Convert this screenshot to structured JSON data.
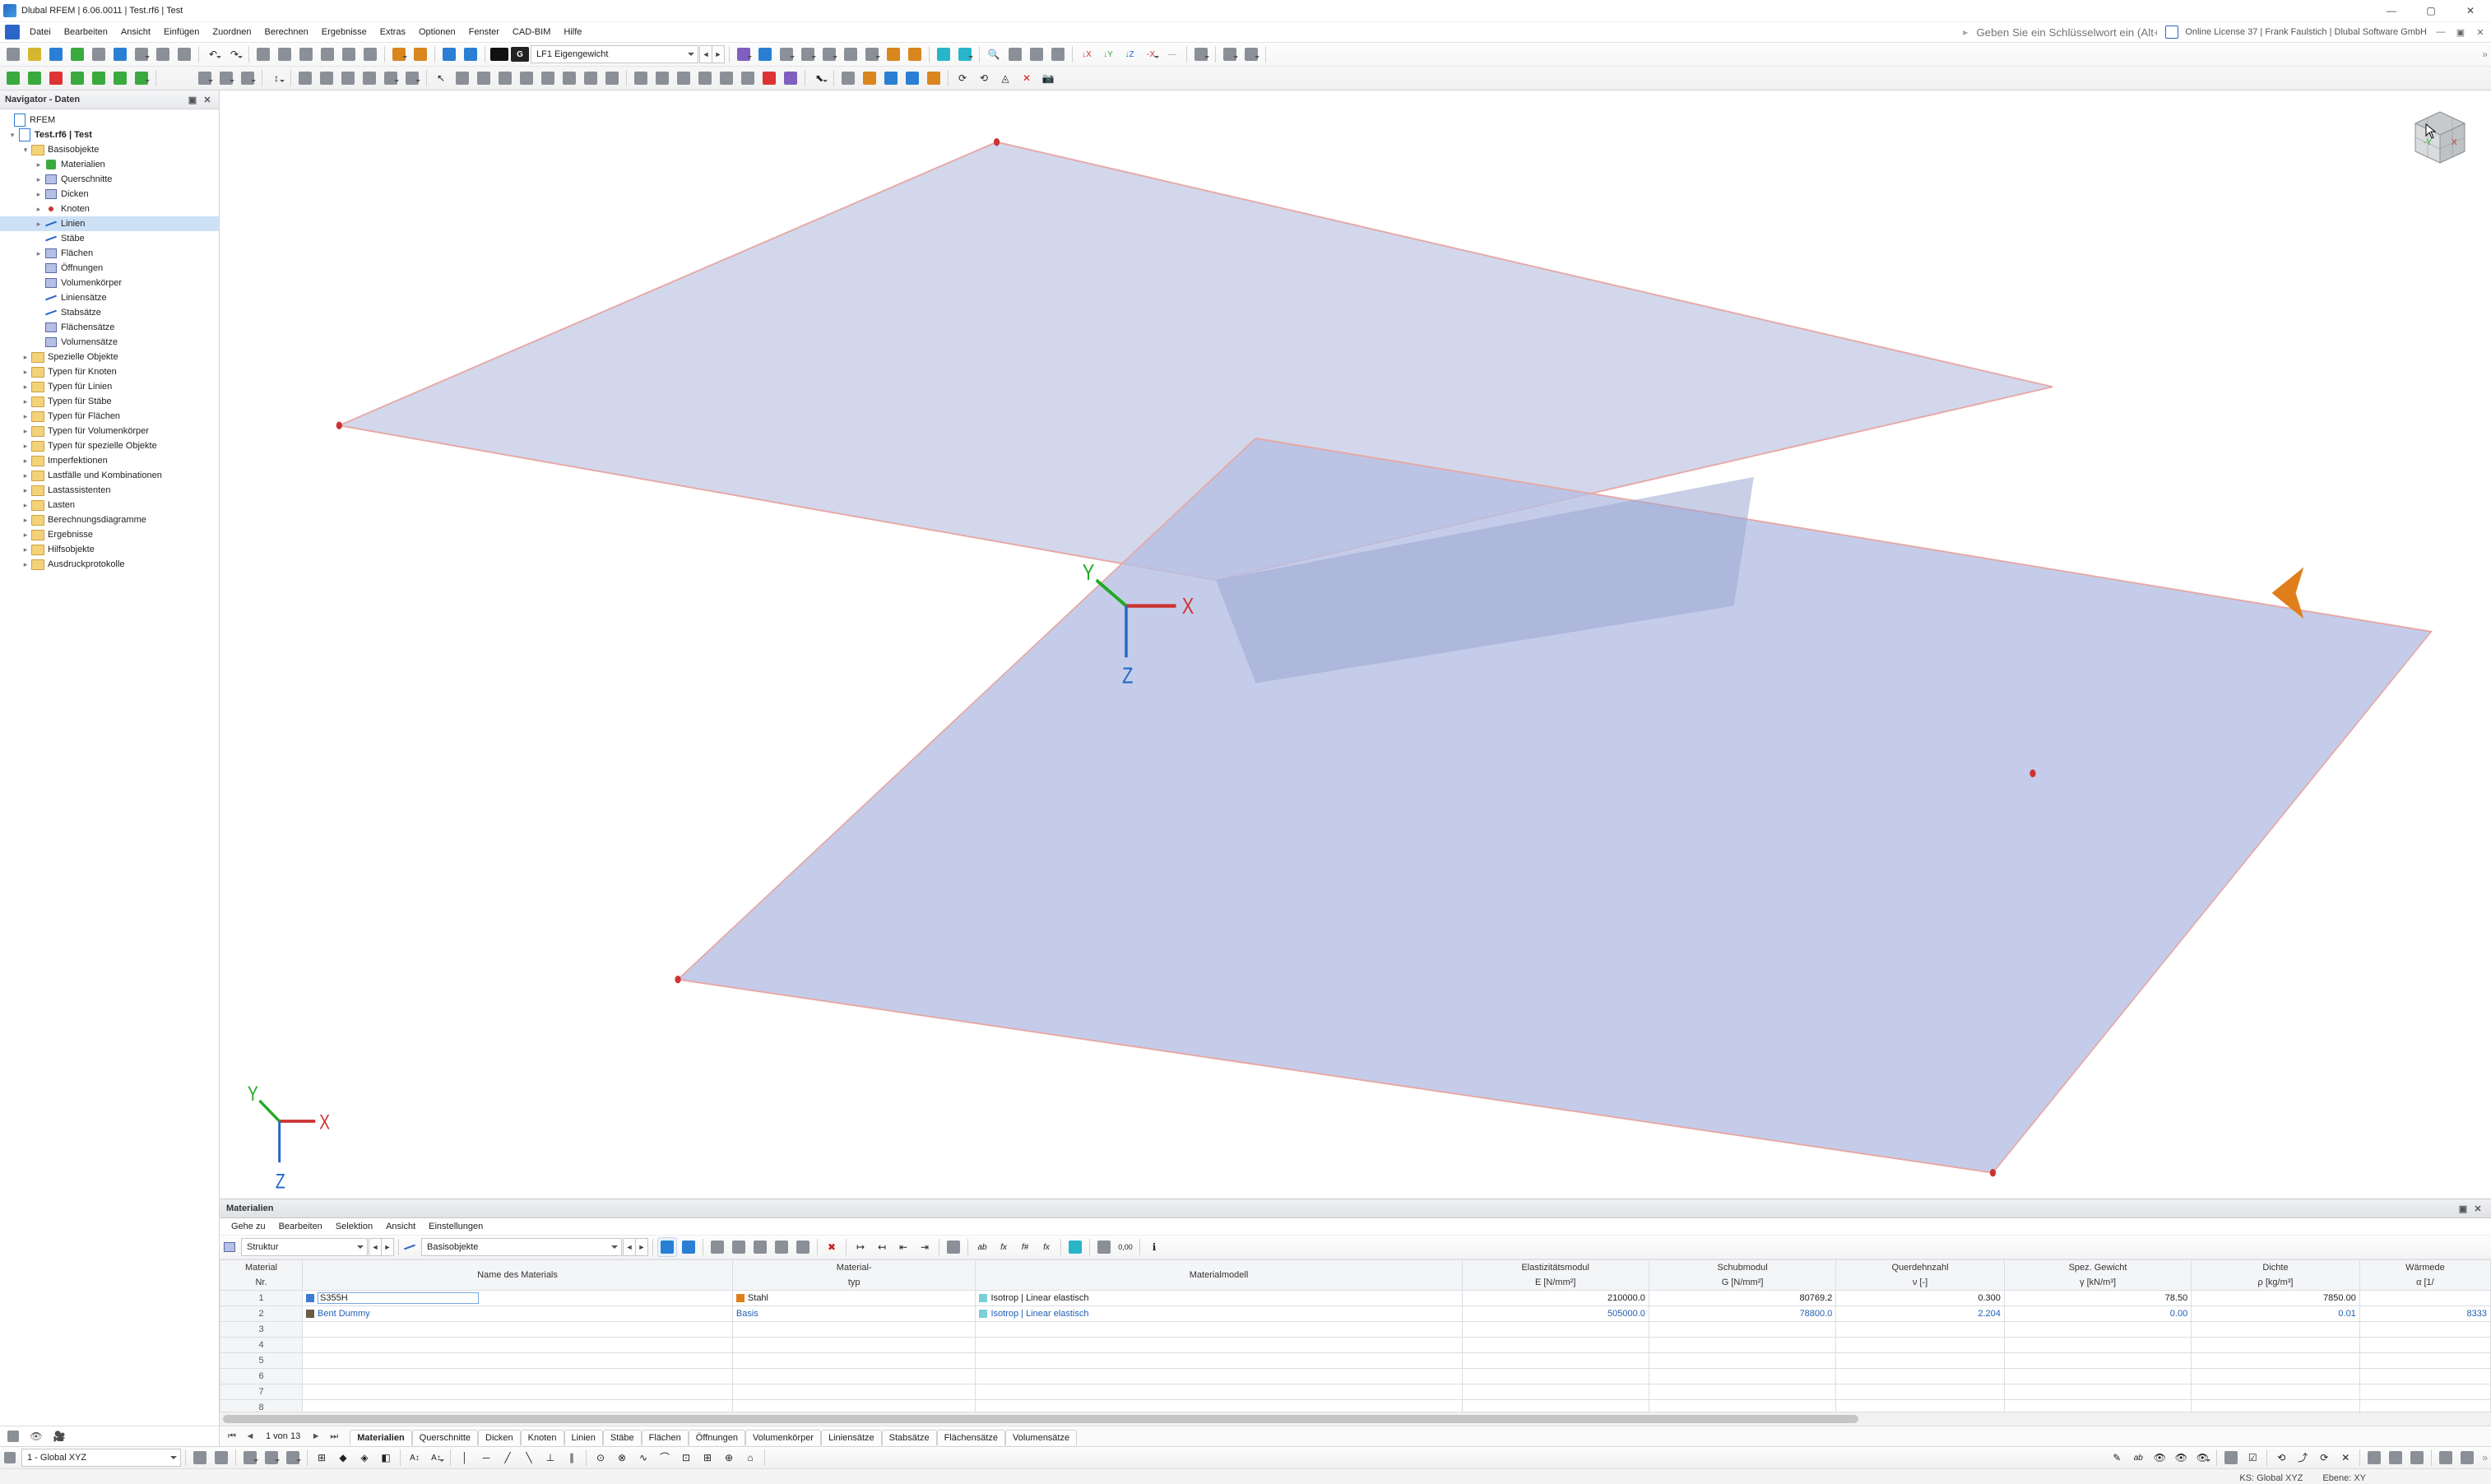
{
  "title": "Dlubal RFEM | 6.06.0011 | Test.rf6 | Test",
  "menu": [
    "Datei",
    "Bearbeiten",
    "Ansicht",
    "Einfügen",
    "Zuordnen",
    "Berechnen",
    "Ergebnisse",
    "Extras",
    "Optionen",
    "Fenster",
    "CAD-BIM",
    "Hilfe"
  ],
  "kw_placeholder": "Geben Sie ein Schlüsselwort ein (Alt+Q)",
  "license": "Online License 37 | Frank Faulstich | Dlubal Software GmbH",
  "lf_combo": "LF1   Eigengewicht",
  "navigator": {
    "title": "Navigator - Daten",
    "root": "RFEM",
    "project": "Test.rf6 | Test",
    "basis": "Basisobjekte",
    "items": [
      "Materialien",
      "Querschnitte",
      "Dicken",
      "Knoten",
      "Linien",
      "Stäbe",
      "Flächen",
      "Öffnungen",
      "Volumenkörper",
      "Liniensätze",
      "Stabsätze",
      "Flächensätze",
      "Volumensätze"
    ],
    "selected": "Linien",
    "groups": [
      "Spezielle Objekte",
      "Typen für Knoten",
      "Typen für Linien",
      "Typen für Stäbe",
      "Typen für Flächen",
      "Typen für Volumenkörper",
      "Typen für spezielle Objekte",
      "Imperfektionen",
      "Lastfälle und Kombinationen",
      "Lastassistenten",
      "Lasten",
      "Berechnungsdiagramme",
      "Ergebnisse",
      "Hilfsobjekte",
      "Ausdruckprotokolle"
    ]
  },
  "panel": {
    "title": "Materialien",
    "menu": [
      "Gehe zu",
      "Bearbeiten",
      "Selektion",
      "Ansicht",
      "Einstellungen"
    ],
    "struct_label": "Struktur",
    "cat_label": "Basisobjekte",
    "headers": {
      "mat_no_1": "Material",
      "mat_no_2": "Nr.",
      "name": "Name des Materials",
      "type_1": "Material-",
      "type_2": "typ",
      "model": "Materialmodell",
      "e_1": "Elastizitätsmodul",
      "e_2": "E [N/mm²]",
      "g_1": "Schubmodul",
      "g_2": "G [N/mm²]",
      "nu_1": "Querdehnzahl",
      "nu_2": "ν [-]",
      "gamma_1": "Spez. Gewicht",
      "gamma_2": "γ [kN/m³]",
      "rho_1": "Dichte",
      "rho_2": "ρ [kg/m³]",
      "alpha_1": "Wärmede",
      "alpha_2": "α [1/"
    },
    "rows": [
      {
        "no": "1",
        "name": "S355H",
        "name_sw": "sw-bl",
        "type": "Stahl",
        "type_sw": "sw-or",
        "model": "Isotrop | Linear elastisch",
        "model_sw": "sw-cy",
        "e": "210000.0",
        "g": "80769.2",
        "nu": "0.300",
        "gamma": "78.50",
        "rho": "7850.00",
        "alpha": "",
        "blue": false
      },
      {
        "no": "2",
        "name": "Bent Dummy",
        "name_sw": "sw-br",
        "type": "Basis",
        "type_sw": "",
        "model": "Isotrop | Linear elastisch",
        "model_sw": "sw-cy",
        "e": "505000.0",
        "g": "78800.0",
        "nu": "2.204",
        "gamma": "0.00",
        "rho": "0.01",
        "alpha": "8333",
        "blue": true
      }
    ],
    "blank_rows": [
      "3",
      "4",
      "5",
      "6",
      "7",
      "8"
    ],
    "pager_text": "1 von 13",
    "tabs": [
      "Materialien",
      "Querschnitte",
      "Dicken",
      "Knoten",
      "Linien",
      "Stäbe",
      "Flächen",
      "Öffnungen",
      "Volumenkörper",
      "Liniensätze",
      "Stabsätze",
      "Flächensätze",
      "Volumensätze"
    ],
    "active_tab": "Materialien"
  },
  "bottom_combo": "1 - Global XYZ",
  "status": {
    "ks": "KS: Global XYZ",
    "ebene": "Ebene: XY"
  },
  "axes": {
    "x": "X",
    "y": "Y",
    "z": "Z"
  },
  "cube": {
    "y": "-Y",
    "x": "X"
  }
}
